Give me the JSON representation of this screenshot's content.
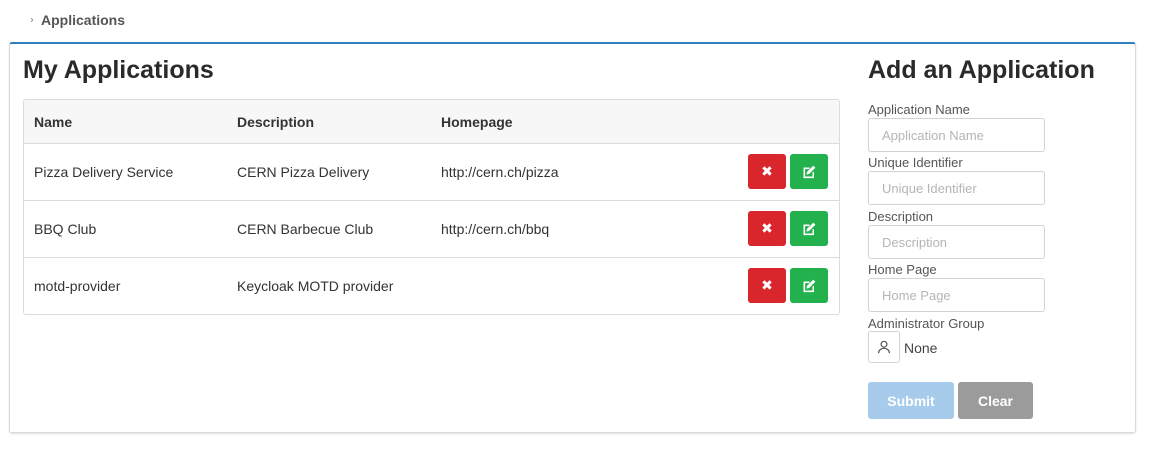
{
  "breadcrumb": {
    "chevron": "›",
    "current": "Applications"
  },
  "my_apps": {
    "title": "My Applications",
    "columns": {
      "name": "Name",
      "description": "Description",
      "homepage": "Homepage"
    },
    "rows": [
      {
        "name": "Pizza Delivery Service",
        "description": "CERN Pizza Delivery",
        "homepage": "http://cern.ch/pizza"
      },
      {
        "name": "BBQ Club",
        "description": "CERN Barbecue Club",
        "homepage": "http://cern.ch/bbq"
      },
      {
        "name": "motd-provider",
        "description": "Keycloak MOTD provider",
        "homepage": ""
      }
    ],
    "delete_glyph": "✖",
    "delete_icon": "times-icon",
    "edit_icon": "edit-icon"
  },
  "add_app": {
    "title": "Add an Application",
    "fields": {
      "name": {
        "label": "Application Name",
        "placeholder": "Application Name",
        "value": ""
      },
      "identifier": {
        "label": "Unique Identifier",
        "placeholder": "Unique Identifier",
        "value": ""
      },
      "description": {
        "label": "Description",
        "placeholder": "Description",
        "value": ""
      },
      "homepage": {
        "label": "Home Page",
        "placeholder": "Home Page",
        "value": ""
      }
    },
    "admin_group": {
      "label": "Administrator Group",
      "value": "None",
      "icon": "user-icon"
    },
    "submit_label": "Submit",
    "clear_label": "Clear"
  },
  "colors": {
    "accent": "#2f7fc1",
    "delete": "#d9262c",
    "edit": "#22b14c",
    "submit": "#a6cbeb",
    "clear": "#9b9b9b"
  }
}
